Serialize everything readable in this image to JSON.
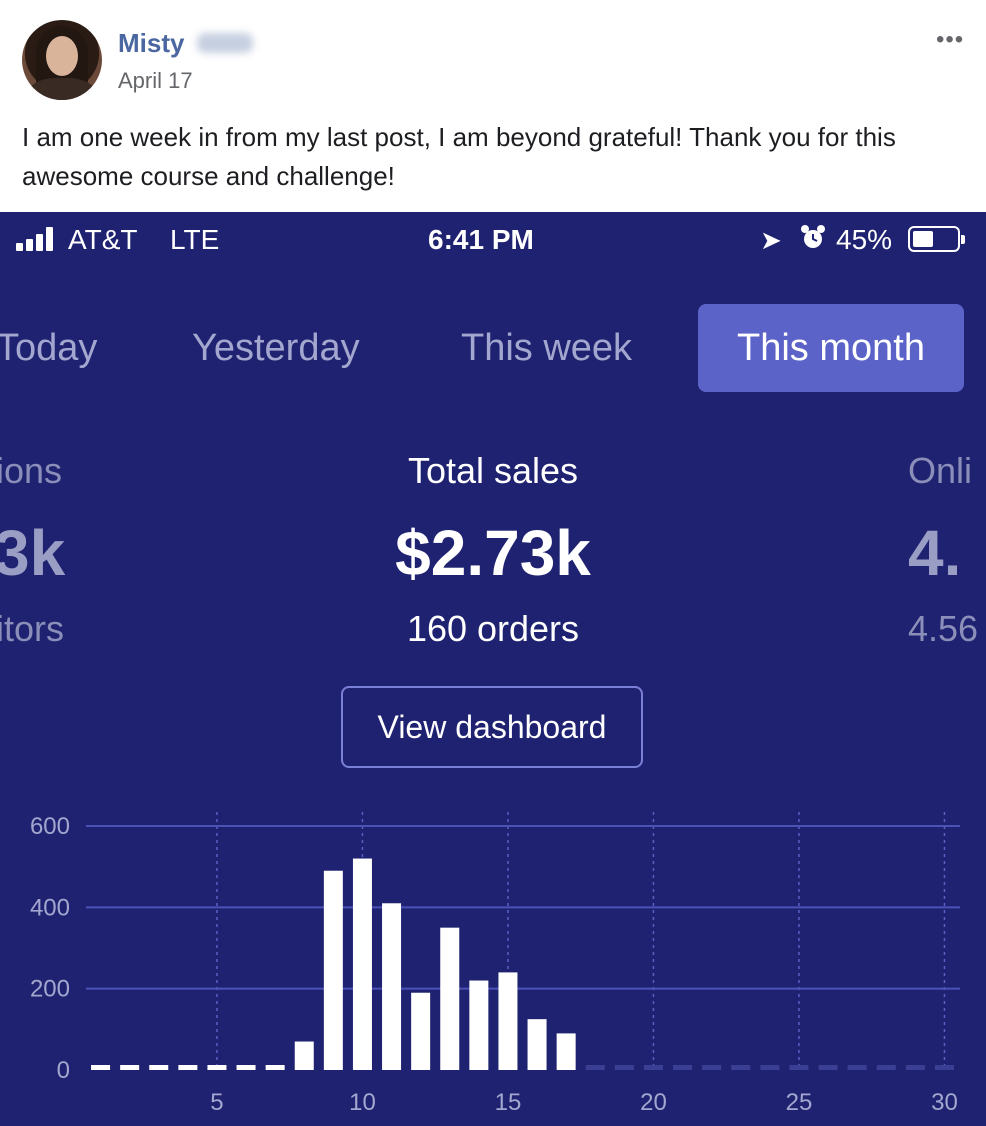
{
  "post": {
    "author": "Misty",
    "date": "April 17",
    "more_glyph": "•••",
    "text": "I am one week in from my last post, I am beyond grateful! Thank you for this awesome course and challenge!"
  },
  "phone": {
    "status_bar": {
      "carrier": "AT&T",
      "network": "LTE",
      "time": "6:41 PM",
      "battery": "45%",
      "battery_level": 0.45,
      "icons": [
        "signal-icon",
        "location-arrow-icon",
        "alarm-clock-icon",
        "battery-icon"
      ]
    },
    "tabs": [
      {
        "label": "Today",
        "active": false
      },
      {
        "label": "Yesterday",
        "active": false
      },
      {
        "label": "This week",
        "active": false
      },
      {
        "label": "This month",
        "active": true
      }
    ],
    "metrics": {
      "left": {
        "label": "ions",
        "value": "3k",
        "sub": "itors"
      },
      "center": {
        "label": "Total sales",
        "value": "$2.73k",
        "sub": "160 orders"
      },
      "right": {
        "label": "Onli",
        "value": "4.",
        "sub": "4.56"
      }
    },
    "view_dashboard_label": "View dashboard",
    "colors": {
      "background": "#1f2270",
      "active_tab": "#5c63c8",
      "bars": "#ffffff",
      "gridline": "#4b52b5"
    }
  },
  "chart_data": {
    "type": "bar",
    "x": [
      1,
      2,
      3,
      4,
      5,
      6,
      7,
      8,
      9,
      10,
      11,
      12,
      13,
      14,
      15,
      16,
      17,
      18,
      19,
      20,
      21,
      22,
      23,
      24,
      25,
      26,
      27,
      28,
      29,
      30
    ],
    "values": [
      0,
      0,
      0,
      0,
      0,
      0,
      0,
      70,
      490,
      520,
      410,
      190,
      350,
      220,
      240,
      125,
      90,
      0,
      0,
      0,
      0,
      0,
      0,
      0,
      0,
      0,
      0,
      0,
      0,
      0
    ],
    "x_ticks": [
      5,
      10,
      15,
      20,
      25,
      30
    ],
    "y_ticks": [
      0,
      200,
      400,
      600
    ],
    "ylim": [
      0,
      600
    ],
    "grid": true
  }
}
